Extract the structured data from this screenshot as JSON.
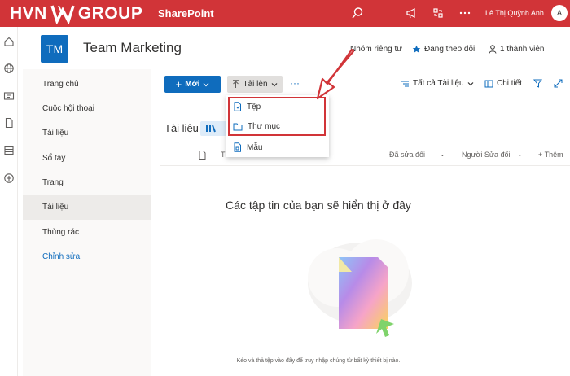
{
  "header": {
    "brand_left": "HVN",
    "brand_right": "GROUP",
    "app_name": "SharePoint",
    "user_name": "Lê Thị Quỳnh Anh",
    "user_initial": "A",
    "colors": {
      "suite_bar": "#d13438",
      "accent": "#0f6cbd"
    }
  },
  "site": {
    "logo_initials": "TM",
    "title": "Team Marketing",
    "privacy": "Nhóm riêng tư",
    "following": "Đang theo dõi",
    "members": "1 thành viên"
  },
  "nav": {
    "items": [
      {
        "label": "Trang chủ"
      },
      {
        "label": "Cuộc hội thoại"
      },
      {
        "label": "Tài liệu"
      },
      {
        "label": "Sổ tay"
      },
      {
        "label": "Trang"
      },
      {
        "label": "Tài liệu",
        "active": true
      },
      {
        "label": "Thùng rác"
      },
      {
        "label": "Chỉnh sửa"
      }
    ]
  },
  "commands": {
    "new_label": "Mới",
    "upload_label": "Tải lên",
    "more_label": "···",
    "view_label": "Tất cả Tài liệu",
    "details_label": "Chi tiết"
  },
  "upload_menu": {
    "items": [
      {
        "label": "Tệp",
        "icon": "file-icon"
      },
      {
        "label": "Thư mục",
        "icon": "folder-icon"
      },
      {
        "label": "Mẫu",
        "icon": "template-icon"
      }
    ]
  },
  "library": {
    "title": "Tài liệu",
    "columns": {
      "name": "Tê",
      "modified": "Đã sửa đổi",
      "modified_by": "Người Sửa đổi",
      "add_column": "Thêm"
    },
    "empty_title": "Các tập tin của bạn sẽ hiển thị ở đây",
    "empty_note": "Kéo và thả tệp vào đây để truy nhập chúng từ bất kỳ thiết bị nào."
  }
}
